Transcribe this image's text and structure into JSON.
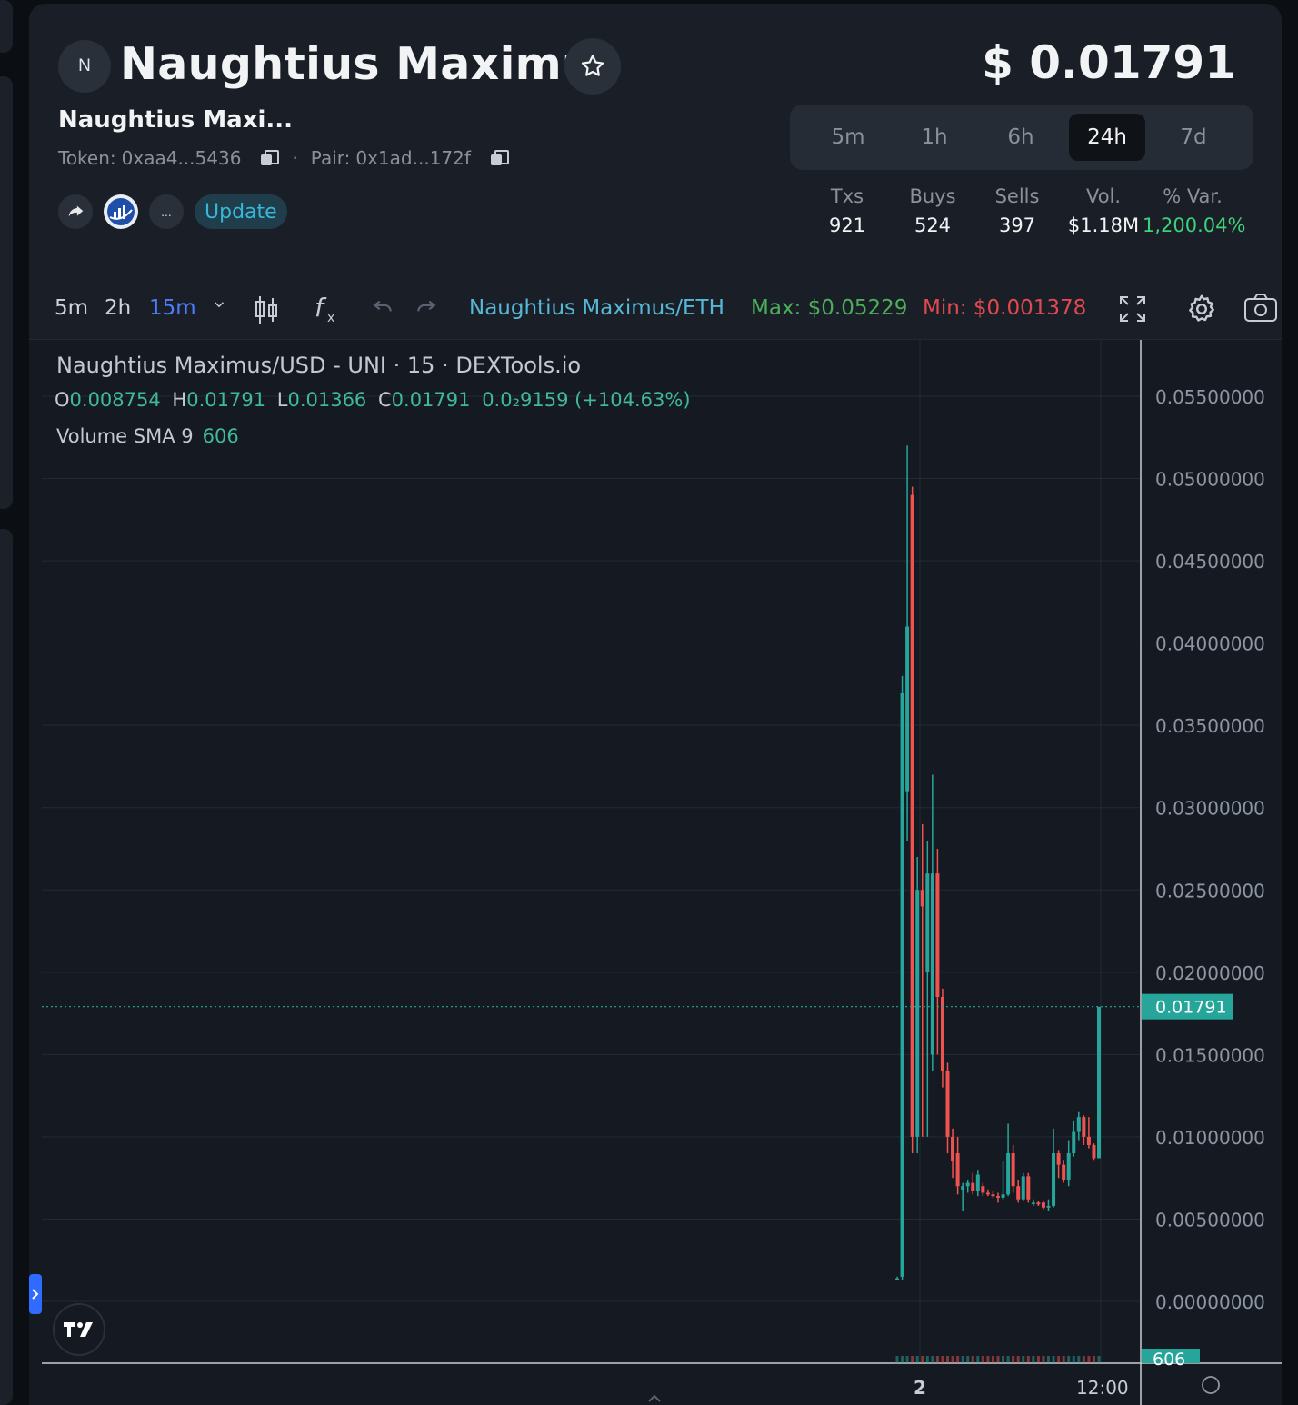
{
  "header": {
    "avatar_letter": "N",
    "token_name": "Naughtius Maximus",
    "subname": "Naughtius Maxi...",
    "token_label": "Token:",
    "token_address": "0xaa4...5436",
    "pair_label": "Pair:",
    "pair_address": "0x1ad...172f",
    "more_label": "...",
    "update_label": "Update",
    "price": "$ 0.01791"
  },
  "timeframes": [
    {
      "label": "5m",
      "active": false
    },
    {
      "label": "1h",
      "active": false
    },
    {
      "label": "6h",
      "active": false
    },
    {
      "label": "24h",
      "active": true
    },
    {
      "label": "7d",
      "active": false
    }
  ],
  "stats": [
    {
      "label": "Txs",
      "value": "921"
    },
    {
      "label": "Buys",
      "value": "524"
    },
    {
      "label": "Sells",
      "value": "397"
    },
    {
      "label": "Vol.",
      "value": "$1.18M"
    },
    {
      "label": "% Var.",
      "value": "1,200.04%"
    }
  ],
  "toolbar": {
    "interval_5m": "5m",
    "interval_2h": "2h",
    "interval_15m": "15m",
    "pair": "Naughtius Maximus/ETH",
    "max": "Max: $0.05229",
    "min": "Min: $0.001378"
  },
  "legend": {
    "title": "Naughtius Maximus/USD - UNI · 15 · DEXTools.io",
    "o_label": "O",
    "o_value": "0.008754",
    "h_label": "H",
    "h_value": "0.01791",
    "l_label": "L",
    "l_value": "0.01366",
    "c_label": "C",
    "c_value": "0.01791",
    "change": "0.0₂9159 (+104.63%)",
    "volume_label": "Volume SMA 9",
    "volume_value": "606"
  },
  "chart_data": {
    "type": "candlestick",
    "title": "Naughtius Maximus/USD - UNI · 15 · DEXTools.io",
    "ylim": [
      0,
      0.058
    ],
    "yticks": [
      "0.05500000",
      "0.05000000",
      "0.04500000",
      "0.04000000",
      "0.03500000",
      "0.03000000",
      "0.02500000",
      "0.02000000",
      "0.01500000",
      "0.01000000",
      "0.00500000",
      "0.00000000"
    ],
    "ytick_values": [
      0.055,
      0.05,
      0.045,
      0.04,
      0.035,
      0.03,
      0.025,
      0.02,
      0.015,
      0.01,
      0.005,
      0
    ],
    "xticks": [
      "2",
      "12:00"
    ],
    "last_price_label": "0.01791",
    "last_price": 0.01791,
    "volume_badge": "606",
    "grid": true,
    "colors": {
      "up": "#26a69a",
      "down": "#ef5350",
      "grid": "#232a35",
      "axis": "#8f96a3"
    },
    "candles": [
      {
        "o": 0.0014,
        "h": 0.0015,
        "l": 0.0013,
        "c": 0.0014
      },
      {
        "o": 0.0015,
        "h": 0.038,
        "l": 0.0013,
        "c": 0.037
      },
      {
        "o": 0.031,
        "h": 0.052,
        "l": 0.028,
        "c": 0.041
      },
      {
        "o": 0.049,
        "h": 0.0495,
        "l": 0.009,
        "c": 0.01
      },
      {
        "o": 0.01,
        "h": 0.027,
        "l": 0.009,
        "c": 0.025
      },
      {
        "o": 0.025,
        "h": 0.029,
        "l": 0.01,
        "c": 0.024
      },
      {
        "o": 0.02,
        "h": 0.028,
        "l": 0.01,
        "c": 0.026
      },
      {
        "o": 0.015,
        "h": 0.032,
        "l": 0.014,
        "c": 0.026
      },
      {
        "o": 0.026,
        "h": 0.0275,
        "l": 0.015,
        "c": 0.0185
      },
      {
        "o": 0.0185,
        "h": 0.019,
        "l": 0.013,
        "c": 0.014
      },
      {
        "o": 0.014,
        "h": 0.0145,
        "l": 0.009,
        "c": 0.01
      },
      {
        "o": 0.01,
        "h": 0.0105,
        "l": 0.0075,
        "c": 0.0085
      },
      {
        "o": 0.009,
        "h": 0.01,
        "l": 0.0065,
        "c": 0.007
      },
      {
        "o": 0.0068,
        "h": 0.0072,
        "l": 0.0055,
        "c": 0.007
      },
      {
        "o": 0.007,
        "h": 0.0074,
        "l": 0.0066,
        "c": 0.0072
      },
      {
        "o": 0.0072,
        "h": 0.0078,
        "l": 0.0065,
        "c": 0.0067
      },
      {
        "o": 0.0067,
        "h": 0.008,
        "l": 0.0064,
        "c": 0.0077
      },
      {
        "o": 0.007,
        "h": 0.0072,
        "l": 0.0064,
        "c": 0.0066
      },
      {
        "o": 0.0066,
        "h": 0.0068,
        "l": 0.0064,
        "c": 0.0065
      },
      {
        "o": 0.0065,
        "h": 0.0067,
        "l": 0.0063,
        "c": 0.0064
      },
      {
        "o": 0.0064,
        "h": 0.0066,
        "l": 0.006,
        "c": 0.0063
      },
      {
        "o": 0.0063,
        "h": 0.0085,
        "l": 0.0062,
        "c": 0.0065
      },
      {
        "o": 0.0065,
        "h": 0.0108,
        "l": 0.0064,
        "c": 0.009
      },
      {
        "o": 0.009,
        "h": 0.0095,
        "l": 0.0066,
        "c": 0.007
      },
      {
        "o": 0.007,
        "h": 0.0074,
        "l": 0.006,
        "c": 0.0062
      },
      {
        "o": 0.0062,
        "h": 0.0078,
        "l": 0.0061,
        "c": 0.0076
      },
      {
        "o": 0.0076,
        "h": 0.0078,
        "l": 0.006,
        "c": 0.0062
      },
      {
        "o": 0.006,
        "h": 0.0062,
        "l": 0.0058,
        "c": 0.006
      },
      {
        "o": 0.006,
        "h": 0.0061,
        "l": 0.0058,
        "c": 0.0059
      },
      {
        "o": 0.006,
        "h": 0.0061,
        "l": 0.0056,
        "c": 0.0057
      },
      {
        "o": 0.0057,
        "h": 0.0062,
        "l": 0.0055,
        "c": 0.0058
      },
      {
        "o": 0.0058,
        "h": 0.0105,
        "l": 0.0057,
        "c": 0.009
      },
      {
        "o": 0.009,
        "h": 0.0092,
        "l": 0.0075,
        "c": 0.0083
      },
      {
        "o": 0.0083,
        "h": 0.0086,
        "l": 0.0072,
        "c": 0.0074
      },
      {
        "o": 0.0074,
        "h": 0.0098,
        "l": 0.007,
        "c": 0.009
      },
      {
        "o": 0.009,
        "h": 0.011,
        "l": 0.0088,
        "c": 0.0103
      },
      {
        "o": 0.0103,
        "h": 0.0115,
        "l": 0.0098,
        "c": 0.0112
      },
      {
        "o": 0.0112,
        "h": 0.0113,
        "l": 0.0095,
        "c": 0.01
      },
      {
        "o": 0.01,
        "h": 0.0112,
        "l": 0.0093,
        "c": 0.0095
      },
      {
        "o": 0.0095,
        "h": 0.0096,
        "l": 0.0086,
        "c": 0.0087
      },
      {
        "o": 0.0087,
        "h": 0.0179,
        "l": 0.0087,
        "c": 0.0179
      }
    ]
  }
}
